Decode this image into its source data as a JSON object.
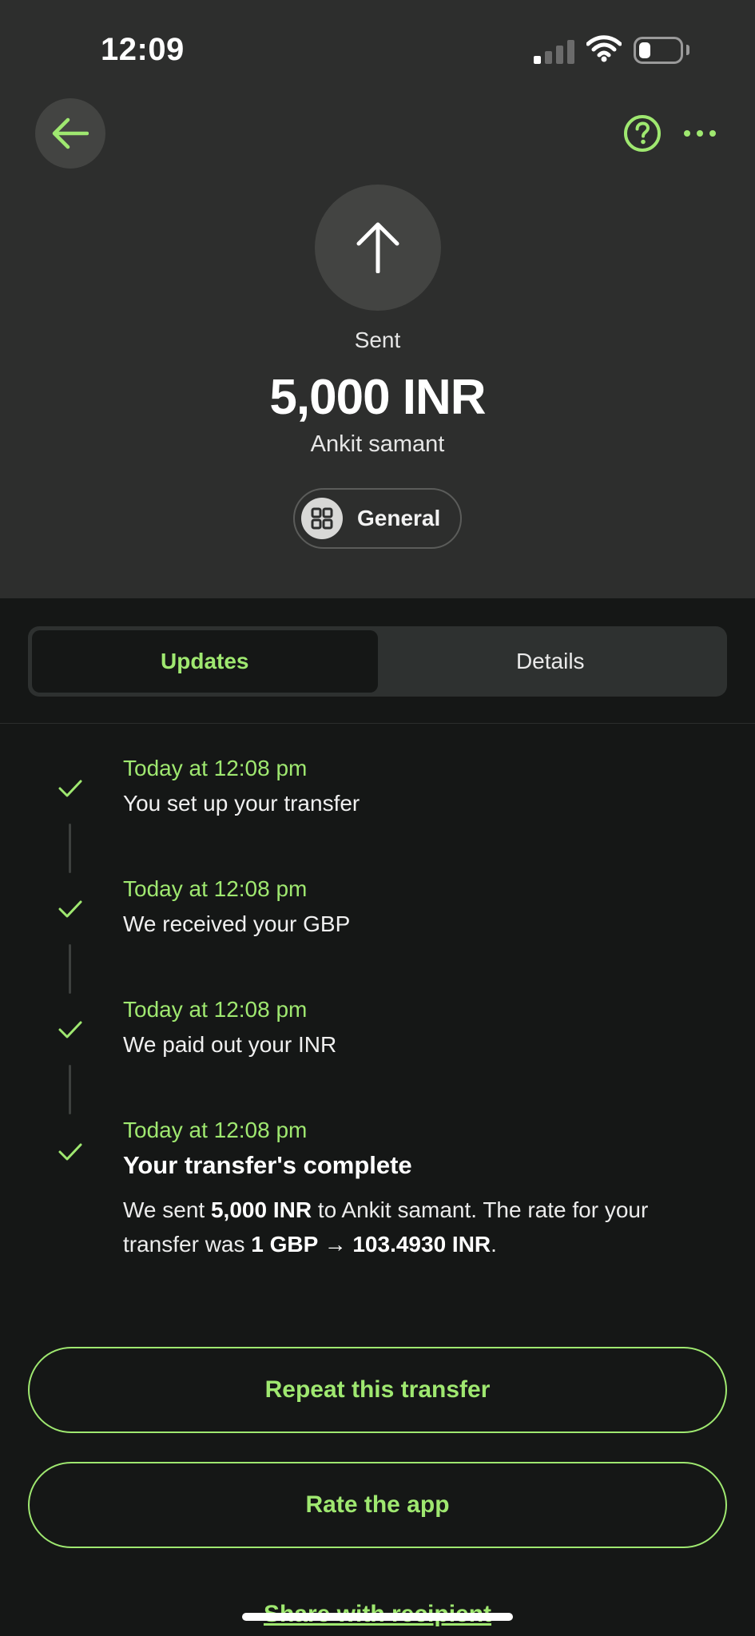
{
  "status_bar": {
    "time": "12:09",
    "battery_level": 0.3
  },
  "header": {
    "back_icon": "arrow-left-icon",
    "help_icon": "question-circle-icon",
    "more_icon": "more-horizontal-icon",
    "direction_icon": "arrow-up-icon",
    "status_label": "Sent",
    "amount": "5,000 INR",
    "recipient": "Ankit samant",
    "category": {
      "icon": "grid-icon",
      "label": "General"
    }
  },
  "tabs": [
    {
      "label": "Updates",
      "active": true
    },
    {
      "label": "Details",
      "active": false
    }
  ],
  "timeline": [
    {
      "time": "Today at 12:08 pm",
      "title": "You set up your transfer",
      "done": true
    },
    {
      "time": "Today at 12:08 pm",
      "title": "We received your GBP",
      "done": true
    },
    {
      "time": "Today at 12:08 pm",
      "title": "We paid out your INR",
      "done": true
    },
    {
      "time": "Today at 12:08 pm",
      "title": "Your transfer's complete",
      "done": true,
      "description": {
        "p1": "We sent ",
        "amount": "5,000 INR",
        "p2": " to Ankit samant. The rate for your transfer was ",
        "rate": "1 GBP → 103.4930 INR",
        "p3": "."
      }
    }
  ],
  "actions": {
    "repeat": "Repeat this transfer",
    "rate": "Rate the app",
    "share": "Share with recipient"
  },
  "colors": {
    "accent": "#9fe870",
    "header_bg": "#2d2e2d",
    "body_bg": "#151716"
  }
}
